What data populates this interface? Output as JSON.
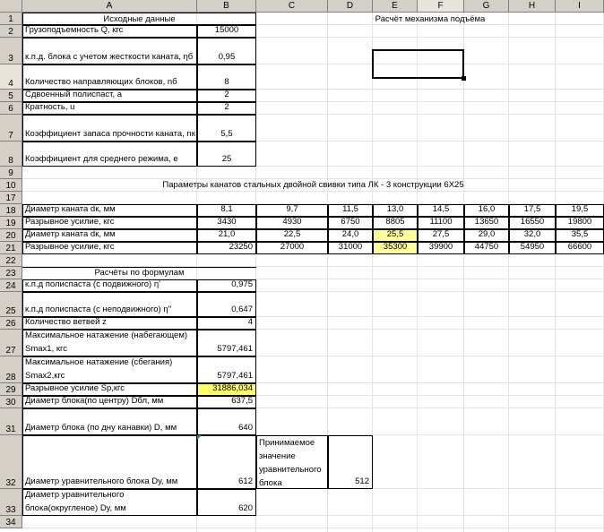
{
  "columns": [
    "A",
    "B",
    "C",
    "D",
    "E",
    "F",
    "G",
    "H",
    "I"
  ],
  "rows": [
    "1",
    "2",
    "3",
    "4",
    "5",
    "6",
    "7",
    "8",
    "9",
    "10",
    "17",
    "18",
    "19",
    "20",
    "21",
    "22",
    "23",
    "24",
    "25",
    "26",
    "27",
    "28",
    "29",
    "30",
    "31",
    "32",
    "33",
    "34"
  ],
  "titles": {
    "input": "Исходные данные",
    "calc": "Расчёт механизма подъёма",
    "ropes": "Параметры канатов стальных двойной свивки типа ЛК - 3 конструкции 6Х25",
    "formulas": "Расчёты по формулам"
  },
  "inputs": [
    {
      "label": "Грузоподъемность Q, кгс",
      "value": "15000"
    },
    {
      "label": "к.п.д. блока с учетом жесткости каната, ηб",
      "value": "0,95"
    },
    {
      "label": "Количество направляющих блоков, nб",
      "value": "8"
    },
    {
      "label": "Сдвоенный полиспаст, a",
      "value": "2"
    },
    {
      "label": "Кратность, u",
      "value": "2"
    },
    {
      "label": "Коэффициент запаса прочности каната, nк",
      "value": "5,5"
    },
    {
      "label": "Коэффициент для среднего режима, e",
      "value": "25"
    }
  ],
  "rope_table": {
    "row18": {
      "label": "Диаметр каната dк, мм",
      "values": [
        "8,1",
        "9,7",
        "11,5",
        "13,0",
        "14,5",
        "16,0",
        "17,5",
        "19,5"
      ]
    },
    "row19": {
      "label": "Разрывное усилие, кгс",
      "values": [
        "3430",
        "4930",
        "6750",
        "8805",
        "11100",
        "13650",
        "16550",
        "19800"
      ]
    },
    "row20": {
      "label": "Диаметр каната dк, мм",
      "values": [
        "21,0",
        "22,5",
        "24,0",
        "25,5",
        "27,5",
        "29,0",
        "32,0",
        "35,5"
      ]
    },
    "row21": {
      "label": "Разрывное усилие, кгс",
      "values": [
        "23250",
        "27000",
        "31000",
        "35300",
        "39900",
        "44750",
        "54950",
        "66600"
      ]
    }
  },
  "formulas": [
    {
      "label": "к.п.д полиспаста (с подвижного) η'",
      "value": "0,975"
    },
    {
      "label": "к.п.д полиспаста (с неподвижного) η''",
      "value": "0,647"
    },
    {
      "label": "Количество ветвей z",
      "value": "4"
    },
    {
      "label": "Максимальное натажение (набегающем) Smax1, кгс",
      "value": "5797,461"
    },
    {
      "label": "Максимальное натажение (сбегания) Smax2,кгс",
      "value": "5797,461"
    },
    {
      "label": "Разрывное усилие Sp,кгс",
      "value": "31886,034"
    },
    {
      "label": "Диаметр блока(по центру) Dбл, мм",
      "value": "637,5"
    },
    {
      "label": "Диаметр блока (по дну канавки) D, мм",
      "value": "640"
    },
    {
      "label": "Диаметр уравнительного блока Dу, мм",
      "value": "612"
    },
    {
      "label": "Диаметр уравнительного блока(округленое) Dу, мм",
      "value": "620"
    }
  ],
  "accepted": {
    "label": "Принимаемое значение уравнительного блока",
    "value": "512"
  },
  "colors": {
    "highlight": "#ffff99",
    "header_bg": "#d4d0c8",
    "selected_header": "#e8e4dc"
  }
}
